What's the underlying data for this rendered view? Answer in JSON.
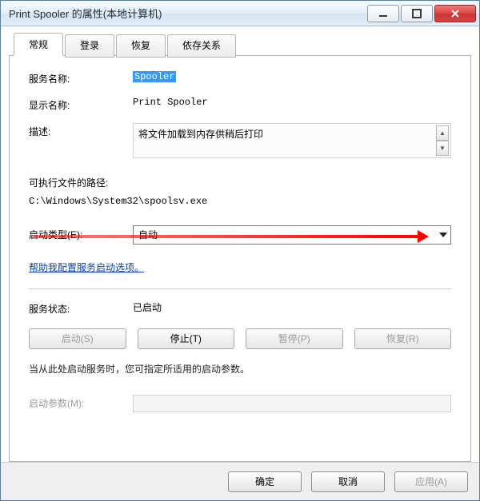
{
  "window": {
    "title": "Print Spooler 的属性(本地计算机)"
  },
  "tabs": [
    "常规",
    "登录",
    "恢复",
    "依存关系"
  ],
  "general": {
    "service_name_label": "服务名称:",
    "service_name_value": "Spooler",
    "display_name_label": "显示名称:",
    "display_name_value": "Print Spooler",
    "description_label": "描述:",
    "description_value": "将文件加载到内存供稍后打印",
    "exe_label": "可执行文件的路径:",
    "exe_path": "C:\\Windows\\System32\\spoolsv.exe",
    "startup_label": "启动类型(E):",
    "startup_value": "自动",
    "help_link": "帮助我配置服务启动选项。",
    "status_label": "服务状态:",
    "status_value": "已启动",
    "buttons": {
      "start": "启动(S)",
      "stop": "停止(T)",
      "pause": "暂停(P)",
      "resume": "恢复(R)"
    },
    "note": "当从此处启动服务时，您可指定所适用的启动参数。",
    "param_label": "启动参数(M):"
  },
  "footer": {
    "ok": "确定",
    "cancel": "取消",
    "apply": "应用(A)"
  }
}
